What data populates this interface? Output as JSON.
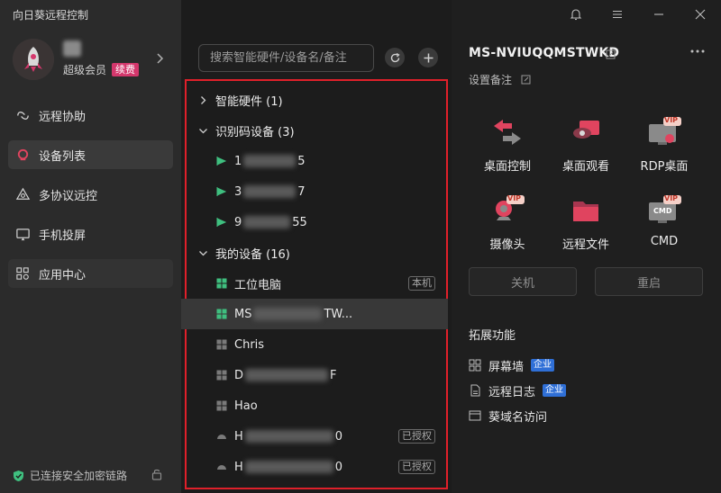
{
  "app": {
    "title": "向日葵远程控制"
  },
  "user": {
    "member_label": "超级会员",
    "renew_badge": "续费"
  },
  "nav": [
    {
      "label": "远程协助",
      "icon": "remote-assist-icon"
    },
    {
      "label": "设备列表",
      "icon": "device-list-icon"
    },
    {
      "label": "多协议远控",
      "icon": "multi-protocol-icon"
    },
    {
      "label": "手机投屏",
      "icon": "screen-cast-icon"
    },
    {
      "label": "应用中心",
      "icon": "app-center-icon"
    }
  ],
  "footer": {
    "status": "已连接安全加密链路"
  },
  "search": {
    "placeholder": "搜索智能硬件/设备名/备注"
  },
  "groups": {
    "smart": "智能硬件 (1)",
    "idcode": "识别码设备 (3)",
    "mine": "我的设备 (16)"
  },
  "idcode_devices": [
    {
      "prefix": "1",
      "suffix": "5"
    },
    {
      "prefix": "3",
      "suffix": "7"
    },
    {
      "prefix": "9",
      "suffix": "55"
    }
  ],
  "my_devices": [
    {
      "prefix": "工位电脑",
      "suffix": "",
      "tag": "本机"
    },
    {
      "prefix": "MS",
      "suffix": "TW...",
      "tag": ""
    },
    {
      "prefix": "Chris",
      "suffix": "",
      "tag": ""
    },
    {
      "prefix": "D",
      "suffix": "F",
      "tag": ""
    },
    {
      "prefix": "Hao",
      "suffix": "",
      "tag": ""
    },
    {
      "prefix": "H",
      "suffix": "0",
      "tag": "已授权"
    },
    {
      "prefix": "H",
      "suffix": "0",
      "tag": "已授权"
    }
  ],
  "detail": {
    "device_name": "MS-NVIUQQMSTWKD",
    "remark": "设置备注",
    "features": [
      {
        "label": "桌面控制",
        "icon": "desktop-control-icon",
        "vip": ""
      },
      {
        "label": "桌面观看",
        "icon": "desktop-view-icon",
        "vip": ""
      },
      {
        "label": "RDP桌面",
        "icon": "rdp-desktop-icon",
        "vip": "VIP"
      },
      {
        "label": "摄像头",
        "icon": "camera-icon",
        "vip": "VIP"
      },
      {
        "label": "远程文件",
        "icon": "remote-file-icon",
        "vip": ""
      },
      {
        "label": "CMD",
        "icon": "cmd-icon",
        "vip": "VIP",
        "screen_text": "CMD"
      }
    ],
    "shutdown": "关机",
    "restart": "重启",
    "ext_title": "拓展功能",
    "ext": [
      {
        "label": "屏幕墙",
        "badge": "企业"
      },
      {
        "label": "远程日志",
        "badge": "企业"
      },
      {
        "label": "葵域名访问",
        "badge": ""
      }
    ]
  },
  "colors": {
    "accent": "#d4376c",
    "frame": "#e0202a",
    "enterprise": "#2f6fd6",
    "online": "#3fbf7f"
  }
}
